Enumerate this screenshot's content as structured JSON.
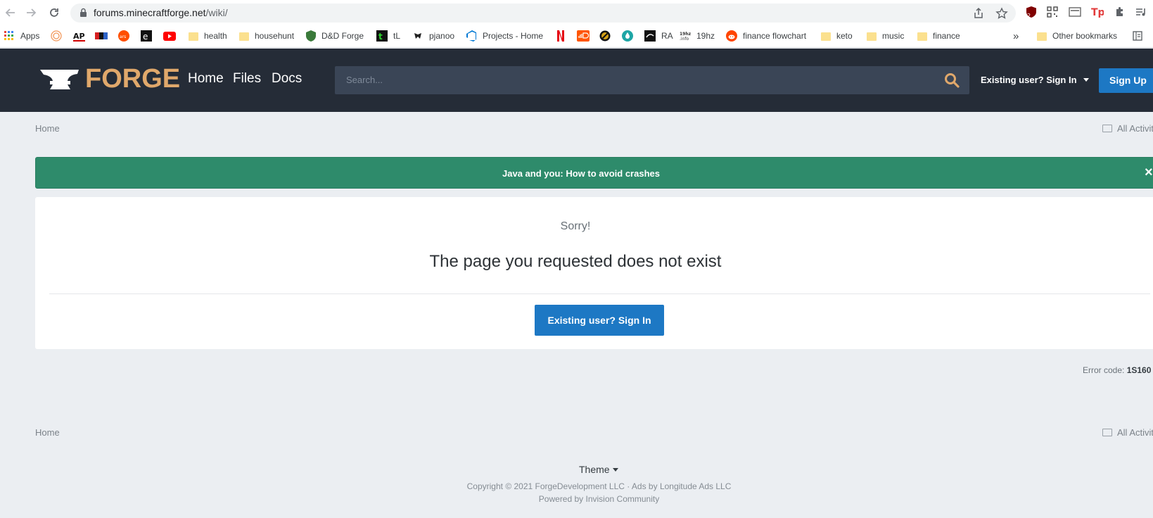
{
  "browser": {
    "url_host": "forums.minecraftforge.net",
    "url_path": "/wiki/",
    "extension_badge": "2",
    "bookmarks": [
      {
        "label": "Apps",
        "icon": "apps-grid-icon",
        "kind": "apps"
      },
      {
        "label": "",
        "icon": "rings-icon",
        "color": "#f29a5e"
      },
      {
        "label": "",
        "icon": "ap-icon",
        "color": "#d10000"
      },
      {
        "label": "",
        "icon": "npr-icon",
        "color": "#2d62c6"
      },
      {
        "label": "",
        "icon": "ars-icon",
        "color": "#ff4e00"
      },
      {
        "label": "",
        "icon": "e-icon",
        "color": "#111111"
      },
      {
        "label": "",
        "icon": "youtube-icon",
        "color": "#ff0000"
      },
      {
        "label": "health",
        "kind": "folder"
      },
      {
        "label": "househunt",
        "kind": "folder"
      },
      {
        "label": "D&D Forge",
        "icon": "shield-icon",
        "color": "#3b7a3b"
      },
      {
        "label": "tL",
        "icon": "tl-icon",
        "color": "#1e7f1e"
      },
      {
        "label": "pjanoo",
        "icon": "pjanoo-icon",
        "color": "#222222"
      },
      {
        "label": "Projects - Home",
        "icon": "azure-devops-icon",
        "color": "#0078d4"
      },
      {
        "label": "",
        "icon": "netflix-icon",
        "color": "#e50914"
      },
      {
        "label": "",
        "icon": "soundcloud-icon",
        "color": "#ff5500"
      },
      {
        "label": "",
        "icon": "circle-slash-icon",
        "color": "#d4a017"
      },
      {
        "label": "",
        "icon": "drop-icon",
        "color": "#1ea6a6"
      },
      {
        "label": "RA",
        "icon": "ra-icon",
        "color": "#111111"
      },
      {
        "label": "19hz",
        "icon": "19hz-icon",
        "color": "#444444"
      },
      {
        "label": "finance flowchart",
        "icon": "reddit-icon",
        "color": "#ff4500"
      },
      {
        "label": "keto",
        "kind": "folder"
      },
      {
        "label": "music",
        "kind": "folder"
      },
      {
        "label": "finance",
        "kind": "folder"
      }
    ],
    "overflow": "»",
    "other_bookmarks": "Other bookmarks"
  },
  "header": {
    "logo_text": "FORGE",
    "nav": [
      "Home",
      "Files",
      "Docs"
    ],
    "search_placeholder": "Search...",
    "signin_label": "Existing user? Sign In",
    "signup_label": "Sign Up"
  },
  "breadcrumb": {
    "home": "Home",
    "all_activity": "All Activity"
  },
  "announcement": {
    "text": "Java and you: How to avoid crashes",
    "close": "×",
    "color": "#2e8b6b"
  },
  "error_panel": {
    "sorry": "Sorry!",
    "message": "The page you requested does not exist",
    "button": "Existing user? Sign In",
    "error_code_label": "Error code:",
    "error_code": "1S160"
  },
  "footer": {
    "home": "Home",
    "all_activity": "All Activity",
    "theme": "Theme",
    "copyright": "Copyright © 2021 ForgeDevelopment LLC · Ads by Longitude Ads LLC",
    "powered": "Powered by Invision Community"
  },
  "colors": {
    "header_bg": "#252c37",
    "accent": "#1d78c4",
    "logo": "#e0a86b"
  }
}
